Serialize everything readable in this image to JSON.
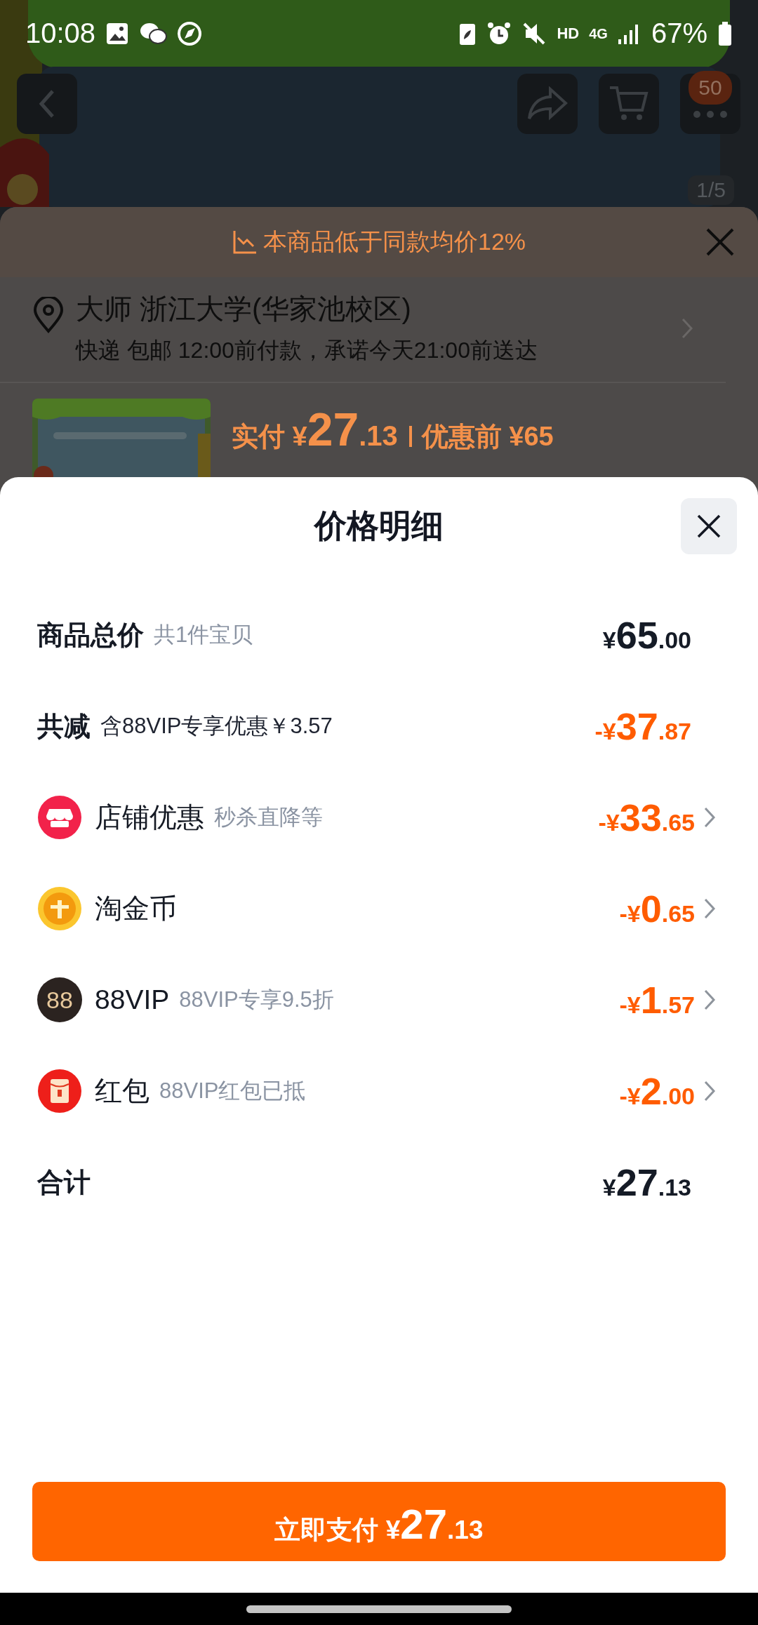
{
  "status_bar": {
    "time": "10:08",
    "hd": "HD",
    "network": "4G",
    "battery": "67%"
  },
  "product_page": {
    "more_badge": "50",
    "image_counter": "1/5"
  },
  "order_sheet": {
    "price_tip": "本商品低于同款均价12%",
    "address": "大师 浙江大学(华家池校区)",
    "delivery": "快递 包邮 12:00前付款，承诺今天21:00前送达",
    "price": {
      "label": "实付",
      "currency": "¥",
      "integer": "27",
      "decimal": ".13",
      "original": "优惠前 ¥65"
    }
  },
  "price_detail": {
    "title": "价格明细",
    "rows": [
      {
        "kind": "subtotal",
        "label": "商品总价",
        "note": "共1件宝贝",
        "deduction": false,
        "amount": {
          "prefix": "¥",
          "integer": "65",
          "decimal": ".00"
        }
      },
      {
        "kind": "savings",
        "label": "共减",
        "note": "含88VIP专享优惠￥3.57",
        "deduction": true,
        "amount": {
          "prefix": "-¥",
          "integer": "37",
          "decimal": ".87"
        }
      },
      {
        "kind": "shop",
        "label": "店铺优惠",
        "note": "秒杀直降等",
        "deduction": true,
        "amount": {
          "prefix": "-¥",
          "integer": "33",
          "decimal": ".65"
        }
      },
      {
        "kind": "coin",
        "label": "淘金币",
        "deduction": true,
        "amount": {
          "prefix": "-¥",
          "integer": "0",
          "decimal": ".65"
        }
      },
      {
        "kind": "vip",
        "icon_text": "88",
        "label": "88VIP",
        "note": "88VIP专享9.5折",
        "deduction": true,
        "amount": {
          "prefix": "-¥",
          "integer": "1",
          "decimal": ".57"
        }
      },
      {
        "kind": "red_packet",
        "label": "红包",
        "note": "88VIP红包已抵",
        "deduction": true,
        "amount": {
          "prefix": "-¥",
          "integer": "2",
          "decimal": ".00"
        }
      },
      {
        "kind": "total",
        "label": "合计",
        "deduction": false,
        "amount": {
          "prefix": "¥",
          "integer": "27",
          "decimal": ".13"
        }
      }
    ]
  },
  "pay_button": {
    "label": "立即支付",
    "currency": "¥",
    "integer": "27",
    "decimal": ".13"
  }
}
